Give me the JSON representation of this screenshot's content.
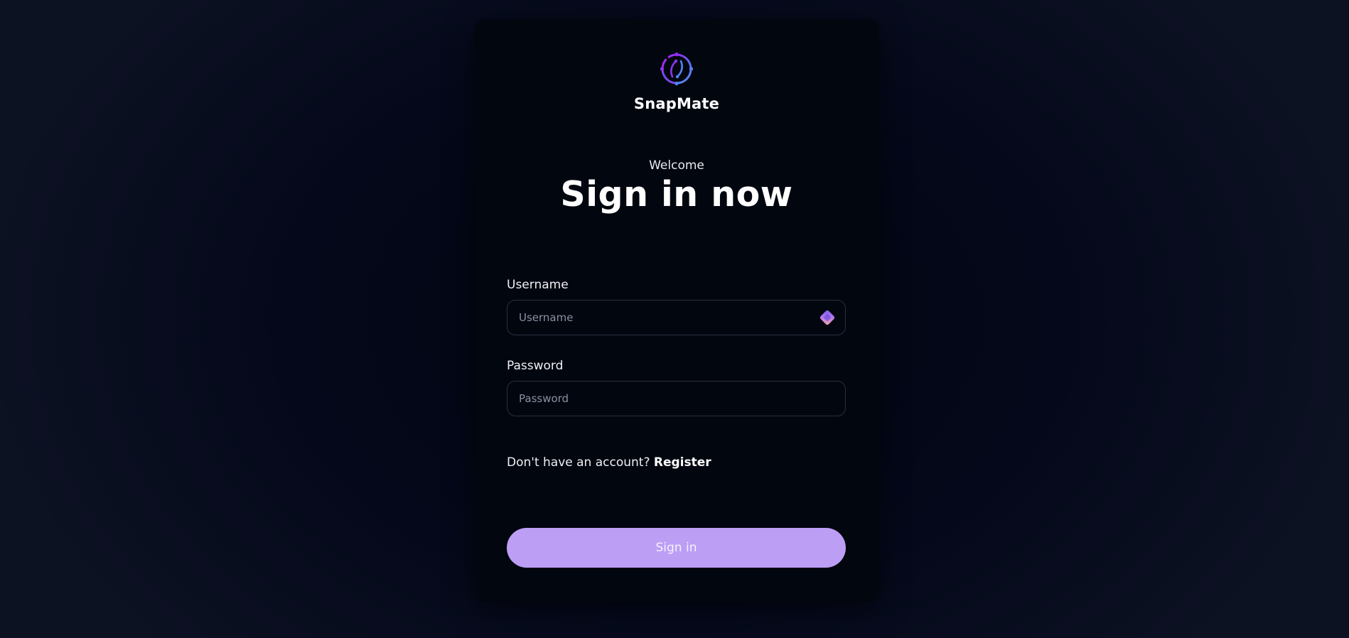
{
  "brand": {
    "name": "SnapMate",
    "logo_icon": "orbit-logo-icon",
    "accent_colors": [
      "#7c3aed",
      "#3b82f6"
    ]
  },
  "header": {
    "welcome": "Welcome",
    "title": "Sign in now"
  },
  "form": {
    "username": {
      "label": "Username",
      "placeholder": "Username",
      "value": "",
      "trailing_icon": "password-manager-icon"
    },
    "password": {
      "label": "Password",
      "placeholder": "Password",
      "value": ""
    }
  },
  "register": {
    "prompt": "Don't have an account?",
    "link_label": "Register"
  },
  "submit": {
    "label": "Sign in",
    "color": "#bd9ef5"
  }
}
